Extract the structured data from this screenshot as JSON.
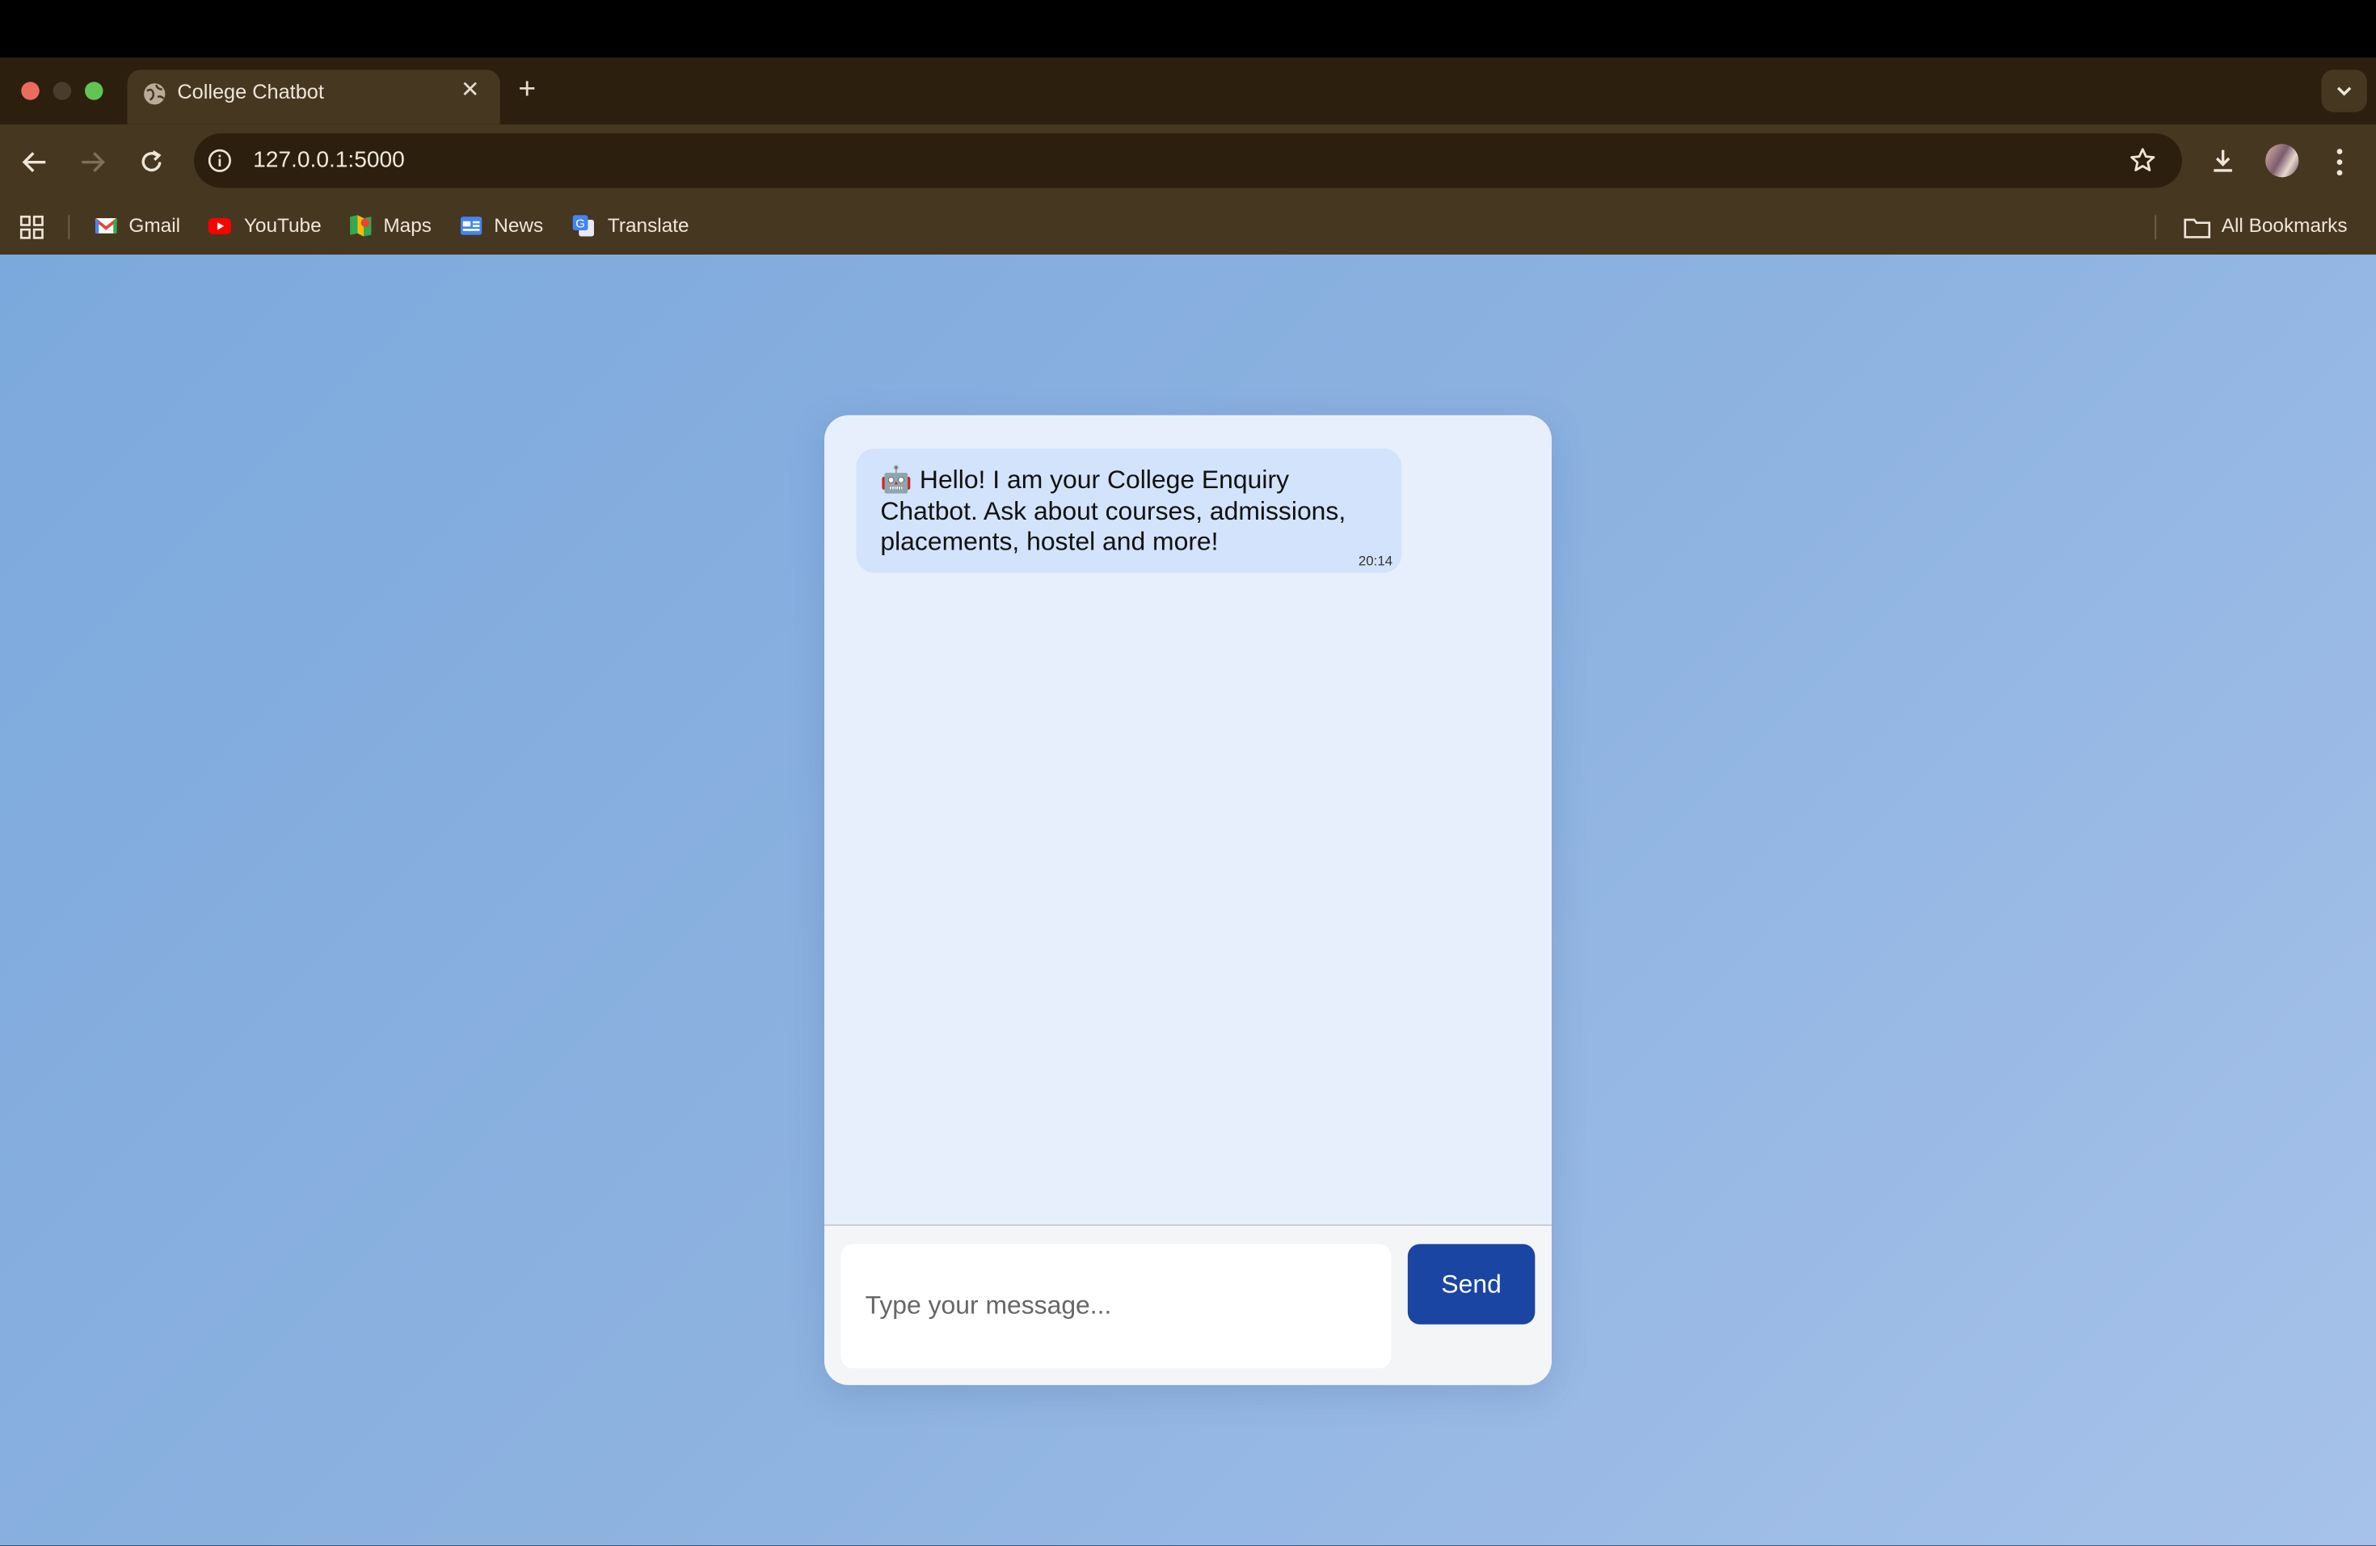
{
  "browser": {
    "tab_title": "College Chatbot",
    "url": "127.0.0.1:5000",
    "new_tab_icon": "plus-icon",
    "bookmarks": [
      {
        "label": "Gmail",
        "icon": "gmail-icon"
      },
      {
        "label": "YouTube",
        "icon": "youtube-icon"
      },
      {
        "label": "Maps",
        "icon": "maps-icon"
      },
      {
        "label": "News",
        "icon": "news-icon"
      },
      {
        "label": "Translate",
        "icon": "translate-icon"
      }
    ],
    "all_bookmarks_label": "All Bookmarks"
  },
  "chat": {
    "messages": [
      {
        "sender": "bot",
        "icon": "robot-emoji-icon",
        "text": "🤖 Hello! I am your College Enquiry Chatbot. Ask about courses, admissions, placements, hostel and more!",
        "time": "20:14"
      }
    ],
    "input_placeholder": "Type your message...",
    "send_label": "Send"
  },
  "colors": {
    "accent": "#1a45a3",
    "bubble": "#d3e3fb",
    "chat_bg": "#e8effc"
  }
}
